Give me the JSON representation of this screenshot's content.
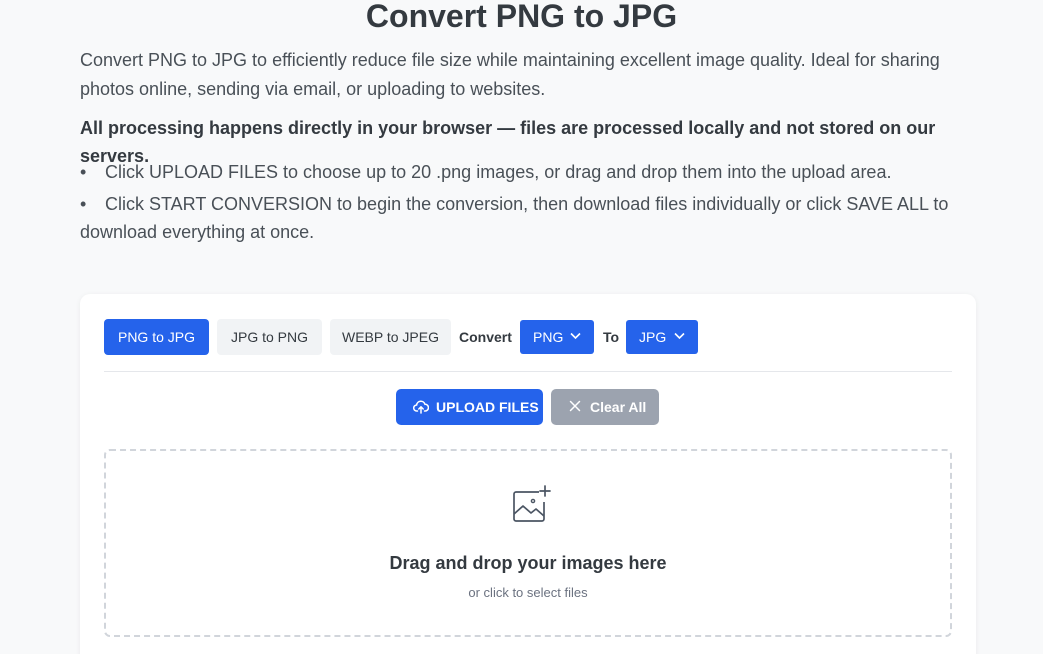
{
  "header": {
    "title": "Convert PNG to JPG",
    "intro": "Convert PNG to JPG to efficiently reduce file size while maintaining excellent image quality. Ideal for sharing photos online, sending via email, or uploading to websites.",
    "privacy": "All processing happens directly in your browser — files are processed locally and not stored on our servers."
  },
  "steps": [
    "Click UPLOAD FILES to choose up to 20 .png images, or drag and drop them into the upload area.",
    "Click START CONVERSION to begin the conversion, then download files individually or click SAVE ALL to download everything at once."
  ],
  "tabs": [
    {
      "label": "PNG to JPG",
      "active": true
    },
    {
      "label": "JPG to PNG",
      "active": false
    },
    {
      "label": "WEBP to JPEG",
      "active": false
    }
  ],
  "converter": {
    "convert_label": "Convert",
    "from_value": "PNG",
    "to_label": "To",
    "to_value": "JPG"
  },
  "actions": {
    "upload_label": "UPLOAD FILES",
    "clear_label": "Clear All"
  },
  "dropzone": {
    "title": "Drag and drop your images here",
    "subtitle": "or click to select files"
  },
  "colors": {
    "accent": "#2563eb",
    "secondary": "#9ca3af",
    "background": "#f8f9fa"
  },
  "icons": [
    "bullet",
    "chevron-down-icon",
    "cloud-upload-icon",
    "close-icon",
    "image-add-icon"
  ]
}
